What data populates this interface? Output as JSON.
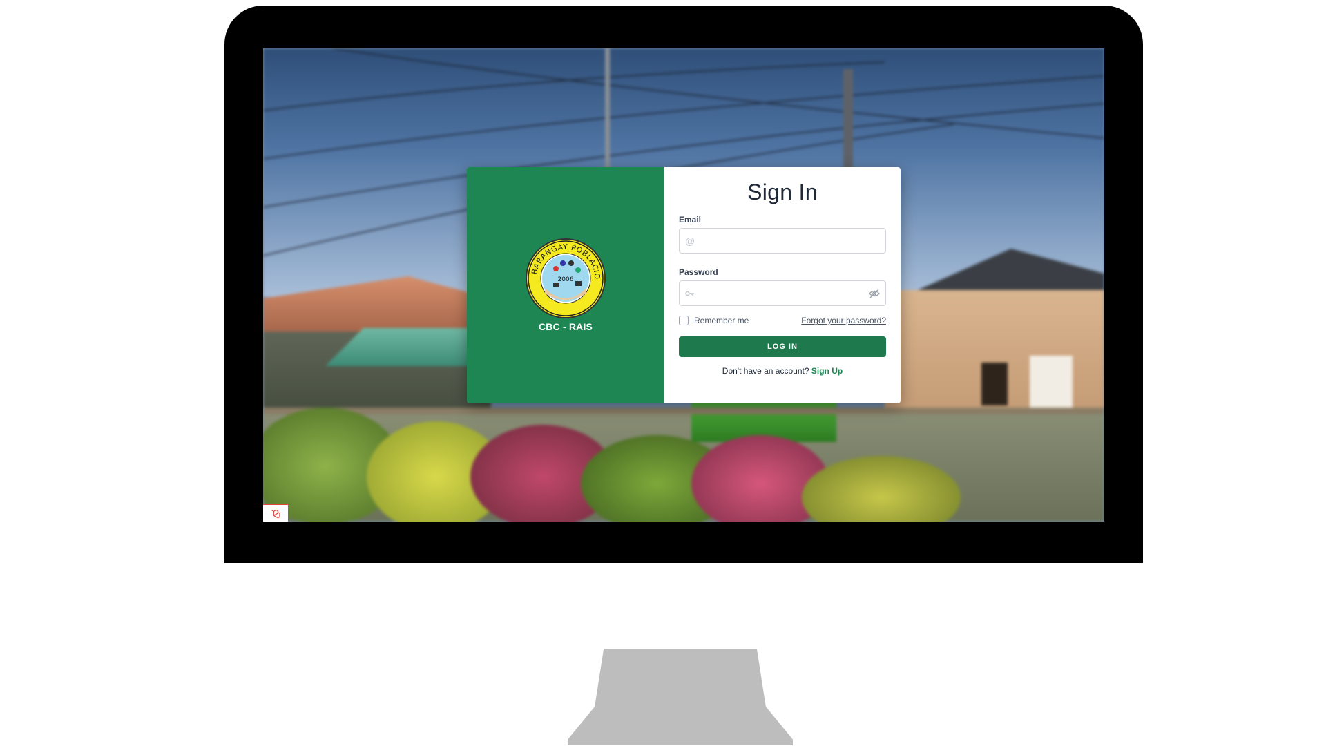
{
  "brand": {
    "logo_icon": "barangay-seal-icon",
    "logo_ring_text": "BARANGAY POBLACION 2",
    "logo_year": "2006",
    "name": "CBC - RAIS"
  },
  "form": {
    "title": "Sign In",
    "email_label": "Email",
    "email_value": "",
    "email_icon": "at-sign-icon",
    "password_label": "Password",
    "password_value": "",
    "password_icon": "key-icon",
    "password_toggle_icon": "eye-off-icon",
    "remember_label": "Remember me",
    "remember_checked": false,
    "forgot_label": "Forgot your password?",
    "login_label": "LOG IN",
    "signup_prompt": "Don't have an account?",
    "signup_label": "Sign Up"
  },
  "footer": {
    "badge_icon": "laravel-logo-icon"
  },
  "colors": {
    "brand_green": "#1e8653",
    "button_green": "#1e7a4d",
    "logo_yellow": "#f4ea1f"
  }
}
